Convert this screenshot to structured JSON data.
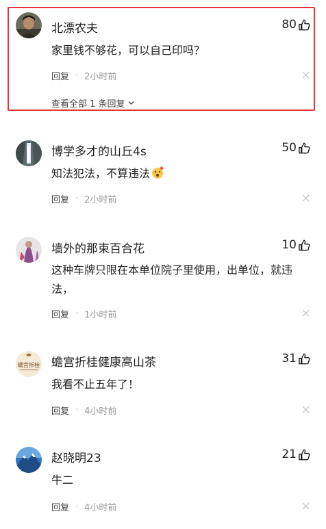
{
  "comments": [
    {
      "username": "北漂农夫",
      "likes": "80",
      "text": "家里钱不够花，可以自己印吗？",
      "reply_label": "回复",
      "time": "2小时前",
      "view_all": "查看全部 1 条回复"
    },
    {
      "username": "博学多才的山丘4s",
      "likes": "50",
      "text": "知法犯法，不算违法",
      "reply_label": "回复",
      "time": "2小时前"
    },
    {
      "username": "墙外的那束百合花",
      "likes": "10",
      "text": "这种车牌只限在本单位院子里使用，出单位，就违法，",
      "reply_label": "回复",
      "time": "1小时前"
    },
    {
      "username": "蟾宫折桂健康高山茶",
      "likes": "31",
      "text": "我看不止五年了！",
      "reply_label": "回复",
      "time": "4小时前",
      "avatar_text": "蟾宫折桂"
    },
    {
      "username": "赵晓明23",
      "likes": "21",
      "text": "牛二",
      "reply_label": "回复",
      "time": "4小时前"
    }
  ],
  "colors": {
    "highlight": "#e5343a",
    "meta": "#999999",
    "text": "#222222"
  },
  "icons": {
    "like": "thumbs-up-icon",
    "close": "close-icon",
    "chevron": "chevron-down-icon",
    "emoji": "astonished-face-emoji"
  }
}
